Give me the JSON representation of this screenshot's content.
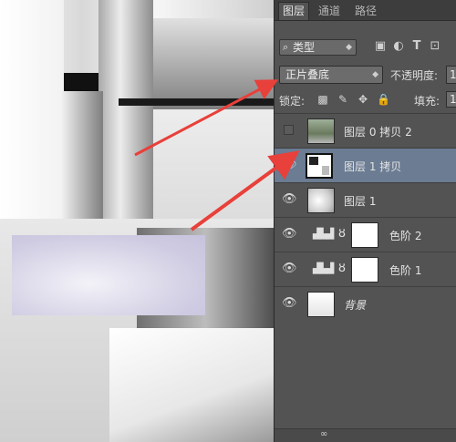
{
  "tabs": [
    "图层",
    "通道",
    "路径"
  ],
  "filter": {
    "label": "类型",
    "magnifier": "⌕"
  },
  "blend_mode": "正片叠底",
  "opacity_label": "不透明度:",
  "opacity_value": "1",
  "lock_label": "锁定:",
  "fill_label": "填充:",
  "fill_value": "1",
  "layers": [
    {
      "name": "图层 0 拷贝 2",
      "visible": false,
      "selected": false
    },
    {
      "name": "图层 1 拷贝",
      "visible": true,
      "selected": true
    },
    {
      "name": "图层 1",
      "visible": true,
      "selected": false
    },
    {
      "name": "色阶 2",
      "visible": true,
      "selected": false
    },
    {
      "name": "色阶 1",
      "visible": true,
      "selected": false
    },
    {
      "name": "背景",
      "visible": true,
      "selected": false
    }
  ],
  "colors": {
    "panel_bg": "#535353",
    "selected_row": "#6b7c93",
    "arrow": "#e8403a"
  },
  "icons": {
    "eye": "eye-icon",
    "levels": "levels-adjustment-icon",
    "chain": "link-icon",
    "lock_transparent": "lock-transparent-icon",
    "lock_brush": "brush-icon",
    "lock_move": "move-icon",
    "lock_all": "lock-icon"
  }
}
